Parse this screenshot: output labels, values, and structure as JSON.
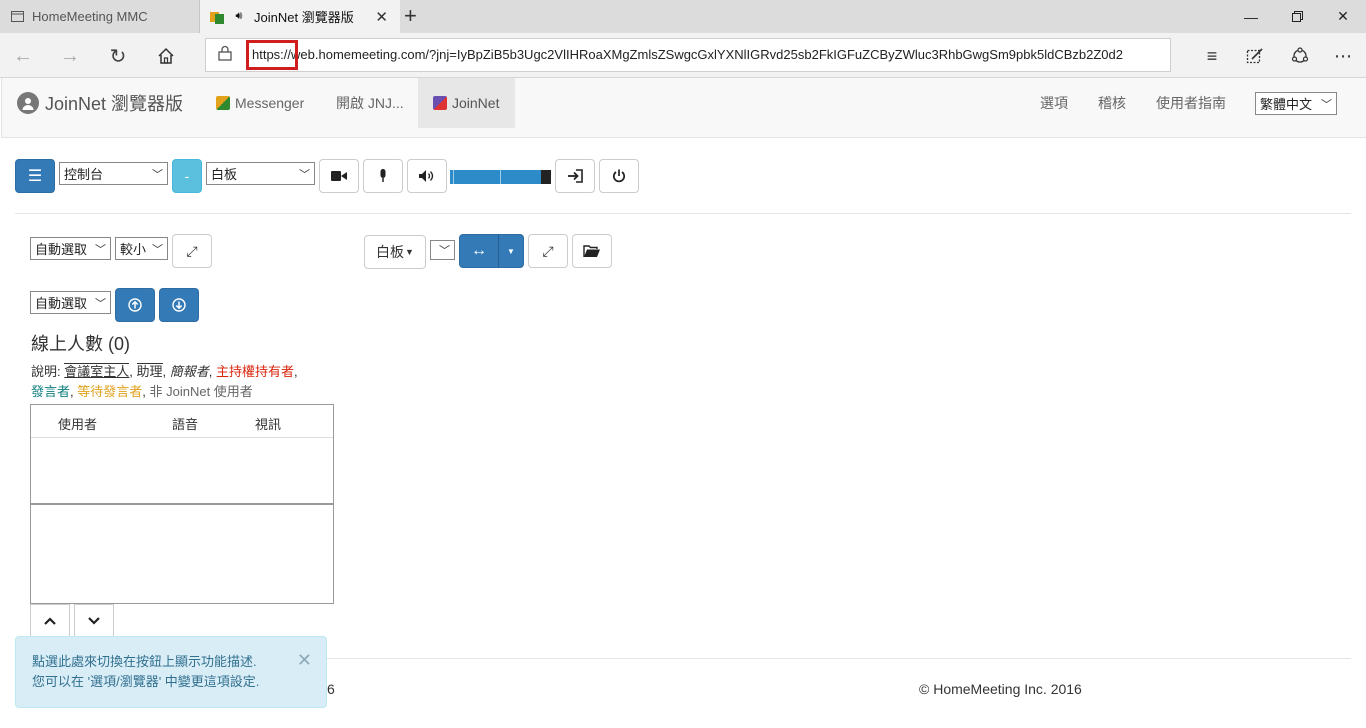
{
  "browser": {
    "tabs": [
      {
        "label": "HomeMeeting MMC"
      },
      {
        "label": "JoinNet 瀏覽器版"
      }
    ],
    "address": "https://web.homemeeting.com/?jnj=IyBpZiB5b3Ugc2VlIHRoaXMgZmlsZSwgcGxlYXNlIGRvd25sb2FkIGFuZCByZWluc3RhbGwgSm9pbk5ldCBzb2Z0d2"
  },
  "app": {
    "brand": "JoinNet 瀏覽器版",
    "nav": [
      {
        "label": "Messenger"
      },
      {
        "label": "開啟 JNJ..."
      },
      {
        "label": "JoinNet"
      }
    ],
    "right_nav": [
      {
        "label": "選項"
      },
      {
        "label": "稽核"
      },
      {
        "label": "使用者指南"
      }
    ],
    "language": "繁體中文"
  },
  "toolbar": {
    "panel_select": "控制台",
    "minus_label": "-",
    "board_select": "白板"
  },
  "left_panel": {
    "auto_select_1": "自動選取",
    "size_select": "較小",
    "auto_select_2": "自動選取"
  },
  "board_panel": {
    "board_dropdown": "白板"
  },
  "online": {
    "title": "線上人數 (0)",
    "legend_prefix": "說明:",
    "host": "會議室主人",
    "assistant": "助理",
    "presenter": "簡報者",
    "chair": "主持權持有者",
    "speaker": "發言者",
    "waiting": "等待發言者",
    "non_user": "非 JoinNet 使用者",
    "columns": [
      "使用者",
      "語音",
      "視訊"
    ]
  },
  "footer": {
    "copyright": "© HomeMeeting Inc. 2016",
    "left_fragment": "6"
  },
  "toast": {
    "line1": "點選此處來切換在按鈕上顯示功能描述.",
    "line2": "您可以在 '選項/瀏覽器' 中變更這項設定."
  },
  "colors": {
    "primary": "#337ab7",
    "info": "#5bc0de",
    "chair_red": "#d9260f",
    "speaker_teal": "#138080",
    "waiting_gold": "#e0a21d",
    "url_highlight": "#d01e1e"
  }
}
